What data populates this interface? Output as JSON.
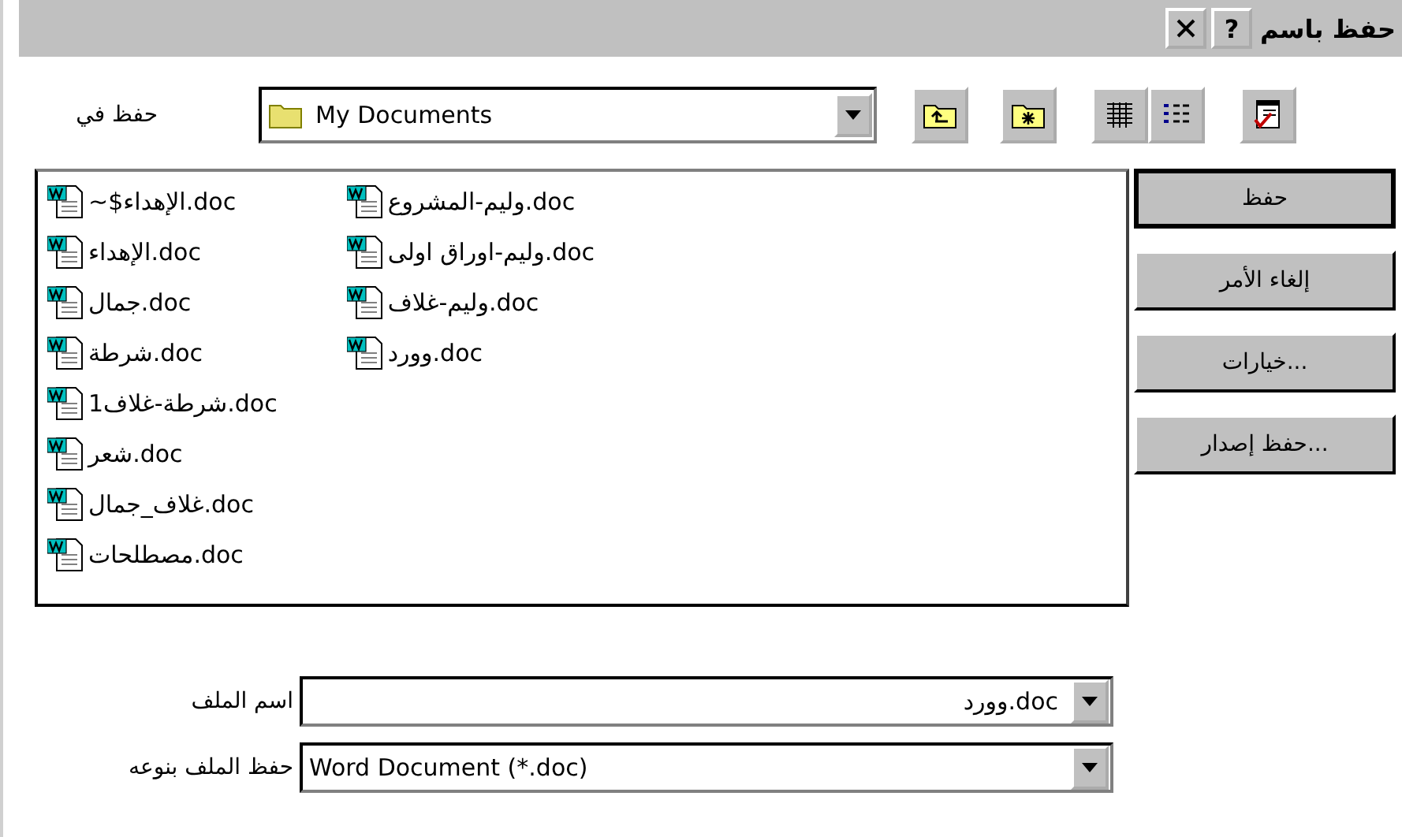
{
  "window": {
    "title": "حفظ باسم",
    "help": "?"
  },
  "save_in": {
    "label": "حفظ في",
    "value": "My Documents"
  },
  "file_columns": [
    [
      "وليم-المشروع.doc",
      "وليم-اوراق اولى.doc",
      "وليم-غلاف.doc",
      "وورد.doc"
    ],
    [
      "~$الإهداء.doc",
      "الإهداء.doc",
      "جمال.doc",
      "شرطة.doc",
      "شرطة-غلاف1.doc",
      "شعر.doc",
      "غلاف_جمال.doc",
      "مصطلحات.doc"
    ]
  ],
  "buttons": [
    {
      "label": "حفظ",
      "default": true
    },
    {
      "label": "إلغاء الأمر",
      "default": false
    },
    {
      "label": "خيارات...",
      "default": false
    },
    {
      "label": "حفظ إصدار...",
      "default": false
    }
  ],
  "file_name": {
    "label": "اسم الملف",
    "value": "وورد.doc"
  },
  "save_as_type": {
    "label": "حفظ الملف بنوعه",
    "value": "Word Document (*.doc)"
  }
}
